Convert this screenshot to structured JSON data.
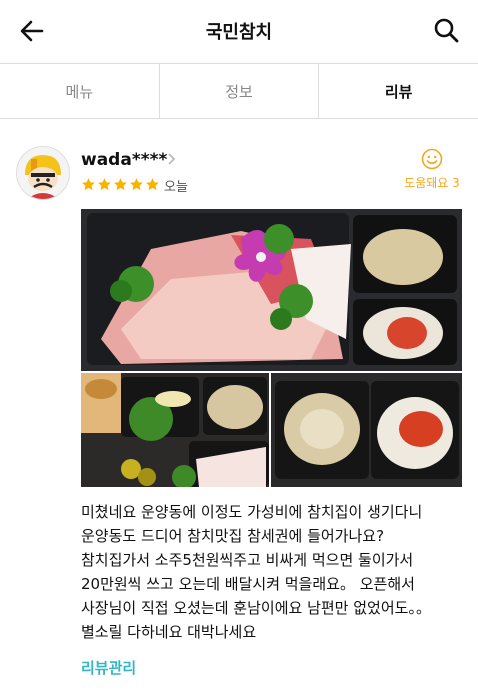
{
  "header": {
    "title": "국민참치"
  },
  "tabs": [
    {
      "label": "메뉴"
    },
    {
      "label": "정보"
    },
    {
      "label": "리뷰"
    }
  ],
  "review": {
    "username": "wada****",
    "rating": 5,
    "date": "오늘",
    "helpful_label": "도움돼요 3",
    "text": "미쳤네요 운양동에 이정도 가성비에 참치집이 생기다니\n운양동도 드디어 참치맛집 참세권에 들어가나요?\n참치집가서 소주5천원씩주고 비싸게 먹으면 둘이가서\n20만원씩 쓰고 오는데 배달시켜 먹을래요。 오픈해서\n사장님이 직접 오셨는데 훈남이에요 남편만 없었어도。。\n별소릴 다하네요 대박나세요",
    "manage_label": "리뷰관리"
  },
  "colors": {
    "star": "#f5b400",
    "helpful": "#f2a81d",
    "manage": "#35b6c4"
  },
  "icons": [
    "back-arrow-icon",
    "search-icon",
    "chevron-right-icon",
    "star-icon",
    "smile-icon"
  ]
}
